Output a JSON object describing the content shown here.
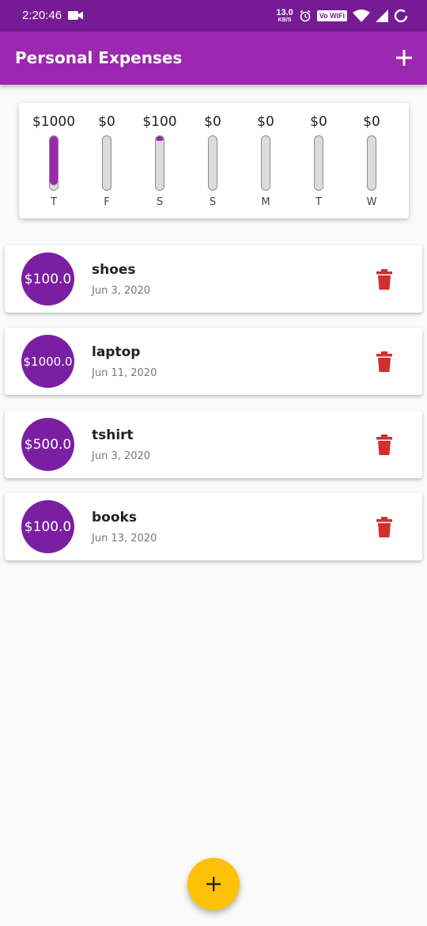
{
  "status_bar": {
    "time": "2:20:46",
    "speed_value": "13.0",
    "speed_unit": "KB/S",
    "wifi_label": "Vo WiFi"
  },
  "app_bar": {
    "title": "Personal Expenses",
    "add_icon": "plus-icon"
  },
  "chart_data": {
    "type": "bar",
    "categories": [
      "T",
      "F",
      "S",
      "S",
      "M",
      "T",
      "W"
    ],
    "values": [
      1000,
      0,
      100,
      0,
      0,
      0,
      0
    ],
    "value_labels": [
      "$1000",
      "$0",
      "$100",
      "$0",
      "$0",
      "$0",
      "$0"
    ],
    "spending_fraction": [
      0.909,
      0,
      0.091,
      0,
      0,
      0,
      0
    ],
    "bar_color": "#9c27b0"
  },
  "transactions": [
    {
      "amount": "$100.0",
      "title": "shoes",
      "date": "Jun 3, 2020"
    },
    {
      "amount": "$1000.0",
      "title": "laptop",
      "date": "Jun 11, 2020"
    },
    {
      "amount": "$500.0",
      "title": "tshirt",
      "date": "Jun 3, 2020"
    },
    {
      "amount": "$100.0",
      "title": "books",
      "date": "Jun 13, 2020"
    }
  ],
  "colors": {
    "primary": "#9c27b0",
    "primary_dark": "#761b94",
    "accent": "#ffc107",
    "delete": "#d32f2f"
  },
  "fab": {
    "icon": "plus-icon"
  }
}
